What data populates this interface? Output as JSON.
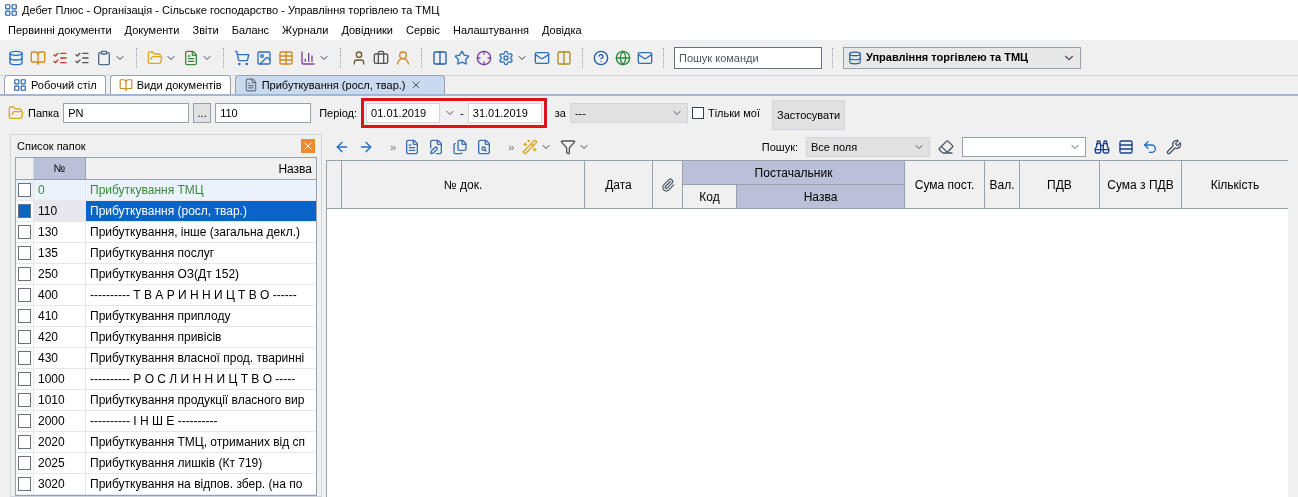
{
  "window": {
    "title": "Дебет Плюс - Організація - Сільське господарство - Управління торгівлею та ТМЦ"
  },
  "menu": [
    "Первинні документи",
    "Документи",
    "Звіти",
    "Баланс",
    "Журнали",
    "Довідники",
    "Сервіс",
    "Налаштування",
    "Довідка"
  ],
  "toolbar": {
    "command_search": {
      "placeholder": "Пошук команди"
    },
    "module_select": {
      "value": "Управління торгівлею та ТМЦ"
    }
  },
  "tabs": [
    {
      "label": "Робочий стіл",
      "selected": false,
      "closable": false
    },
    {
      "label": "Види документів",
      "selected": false,
      "closable": false
    },
    {
      "label": "Прибуткування (росл, твар.)",
      "selected": true,
      "closable": true
    }
  ],
  "filter": {
    "folder_label": "Папка",
    "folder_value": "PN",
    "browse": "...",
    "code_value": "110",
    "period_label": "Період:",
    "period_from": "01.01.2019",
    "dash": "-",
    "period_to": "31.01.2019",
    "period_highlighted": true,
    "by_label": "за",
    "by_value": "---",
    "only_mine_label": "Тільки мої",
    "only_mine_checked": false,
    "apply": "Застосувати"
  },
  "folders": {
    "title": "Список папок",
    "columns": [
      "№",
      "Назва"
    ],
    "rows": [
      {
        "code": "0",
        "name": "Прибуткування ТМЦ",
        "kind": "root",
        "selected": false
      },
      {
        "code": "110",
        "name": "Прибуткування (росл, твар.)",
        "kind": "folder",
        "selected": true
      },
      {
        "code": "130",
        "name": "Прибуткування, інше (загальна декл.)",
        "kind": "folder",
        "selected": false
      },
      {
        "code": "135",
        "name": "Прибуткування послуг",
        "kind": "folder",
        "selected": false
      },
      {
        "code": "250",
        "name": "Прибуткування ОЗ(Дт 152)",
        "kind": "folder",
        "selected": false
      },
      {
        "code": "400",
        "name": "---------- Т В А Р И Н Н И Ц Т В О ------",
        "kind": "folder",
        "selected": false
      },
      {
        "code": "410",
        "name": "Прибуткування приплоду",
        "kind": "folder",
        "selected": false
      },
      {
        "code": "420",
        "name": "Прибуткування привісів",
        "kind": "folder",
        "selected": false
      },
      {
        "code": "430",
        "name": "Прибуткування власної прод. тваринні",
        "kind": "folder",
        "selected": false
      },
      {
        "code": "1000",
        "name": "---------- Р О С Л И Н Н И Ц Т В О -----",
        "kind": "folder",
        "selected": false
      },
      {
        "code": "1010",
        "name": "Прибуткування продукції власного вир",
        "kind": "folder",
        "selected": false
      },
      {
        "code": "2000",
        "name": "---------- І Н Ш Е ----------",
        "kind": "folder",
        "selected": false
      },
      {
        "code": "2020",
        "name": "Прибуткування ТМЦ, отриманих від сп",
        "kind": "folder",
        "selected": false
      },
      {
        "code": "2025",
        "name": "Прибуткування лишків (Кт 719)",
        "kind": "folder",
        "selected": false
      },
      {
        "code": "3020",
        "name": "Прибуткування на відпов. збер. (на по",
        "kind": "folder",
        "selected": false
      }
    ]
  },
  "documents": {
    "search_label": "Пошук:",
    "search_scope": "Все поля",
    "more": "»",
    "columns": {
      "doc_no": "№ док.",
      "date": "Дата",
      "supplier": "Постачальник",
      "supplier_code": "Код",
      "supplier_name": "Назва",
      "amount": "Сума пост.",
      "currency": "Вал.",
      "vat": "ПДВ",
      "total": "Сума з ПДВ",
      "quantity": "Кількість"
    }
  }
}
